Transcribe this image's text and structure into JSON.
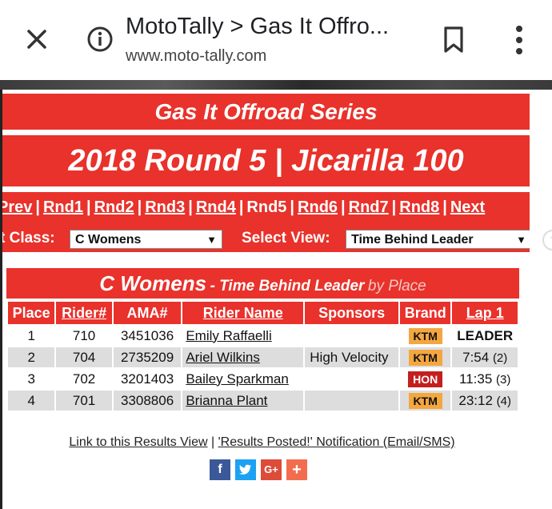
{
  "browser": {
    "title": "MotoTally > Gas It Offro...",
    "url": "www.moto-tally.com",
    "icons": [
      "close-icon",
      "info-icon",
      "bookmark-icon",
      "more-vert-icon"
    ]
  },
  "site": {
    "series": "Gas It Offroad Series",
    "round_title": "2018 Round 5 | Jicarilla 100",
    "nav": {
      "prev": "Prev",
      "rounds": [
        "Rnd1",
        "Rnd2",
        "Rnd3",
        "Rnd4",
        "Rnd5",
        "Rnd6",
        "Rnd7",
        "Rnd8"
      ],
      "current_round": "Rnd5",
      "next": "Next"
    },
    "class_label": "t Class:",
    "class_value": "C Womens",
    "view_label": "Select View:",
    "view_value": "Time Behind Leader"
  },
  "results": {
    "class_name": "C Womens",
    "view_name": "- Time Behind Leader",
    "by": "by Place",
    "columns": [
      "Place",
      "Rider#",
      "AMA#",
      "Rider Name",
      "Sponsors",
      "Brand",
      "Lap 1"
    ],
    "rows": [
      {
        "place": "1",
        "rider": "710",
        "ama": "3451036",
        "name": "Emily Raffaelli",
        "sponsor": "",
        "brand": "KTM",
        "lap": "LEADER",
        "lap_pos": ""
      },
      {
        "place": "2",
        "rider": "704",
        "ama": "2735209",
        "name": "Ariel Wilkins",
        "sponsor": "High Velocity",
        "brand": "KTM",
        "lap": "7:54",
        "lap_pos": "(2)"
      },
      {
        "place": "3",
        "rider": "702",
        "ama": "3201403",
        "name": "Bailey Sparkman",
        "sponsor": "",
        "brand": "HON",
        "lap": "11:35",
        "lap_pos": "(3)"
      },
      {
        "place": "4",
        "rider": "701",
        "ama": "3308806",
        "name": "Brianna Plant",
        "sponsor": "",
        "brand": "KTM",
        "lap": "23:12",
        "lap_pos": "(4)"
      }
    ]
  },
  "footer": {
    "link1": "Link to this Results View",
    "separator": "|",
    "link2": "'Results Posted!' Notification (Email/SMS)",
    "social": [
      {
        "name": "facebook-icon",
        "glyph": "f",
        "color": "#3b5998"
      },
      {
        "name": "twitter-icon",
        "glyph": "t",
        "color": "#1da1f2"
      },
      {
        "name": "google-plus-icon",
        "glyph": "G+",
        "color": "#dd4b39"
      },
      {
        "name": "share-plus-icon",
        "glyph": "+",
        "color": "#f26d4f"
      }
    ]
  },
  "colors": {
    "accent": "#e8322b",
    "ktm": "#f4a640",
    "hon": "#c41f1f"
  }
}
